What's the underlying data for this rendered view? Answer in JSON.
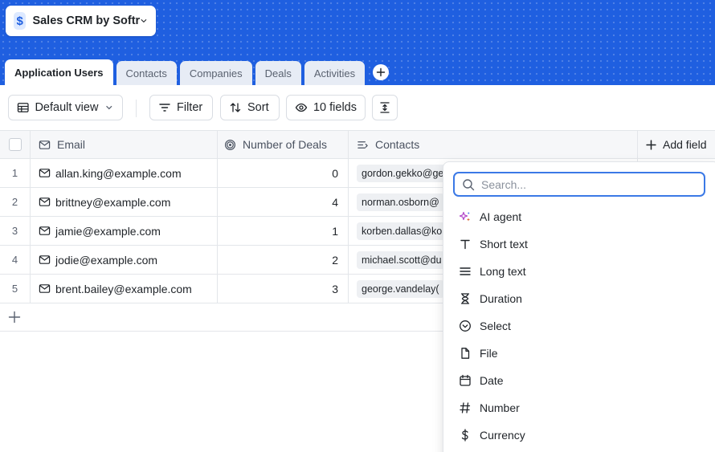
{
  "app": {
    "title": "Sales CRM by Softr",
    "logo_glyph": "$",
    "brand_color": "#1f5fe0"
  },
  "tabs": [
    {
      "label": "Application Users",
      "active": true
    },
    {
      "label": "Contacts",
      "active": false
    },
    {
      "label": "Companies",
      "active": false
    },
    {
      "label": "Deals",
      "active": false
    },
    {
      "label": "Activities",
      "active": false
    }
  ],
  "toolbar": {
    "view_label": "Default view",
    "filter_label": "Filter",
    "sort_label": "Sort",
    "fields_label": "10 fields"
  },
  "columns": {
    "email": "Email",
    "deals": "Number of Deals",
    "contacts": "Contacts",
    "add_field": "Add field"
  },
  "rows": [
    {
      "num": "1",
      "email": "allan.king@example.com",
      "deals": "0",
      "contact": "gordon.gekko@ge"
    },
    {
      "num": "2",
      "email": "brittney@example.com",
      "deals": "4",
      "contact": "norman.osborn@"
    },
    {
      "num": "3",
      "email": "jamie@example.com",
      "deals": "1",
      "contact": "korben.dallas@ko"
    },
    {
      "num": "4",
      "email": "jodie@example.com",
      "deals": "2",
      "contact": "michael.scott@du"
    },
    {
      "num": "5",
      "email": "brent.bailey@example.com",
      "deals": "3",
      "contact": "george.vandelay("
    }
  ],
  "field_menu": {
    "search_placeholder": "Search...",
    "items": [
      {
        "label": "AI agent",
        "icon": "sparkle-icon"
      },
      {
        "label": "Short text",
        "icon": "text-t-icon"
      },
      {
        "label": "Long text",
        "icon": "lines-icon"
      },
      {
        "label": "Duration",
        "icon": "hourglass-icon"
      },
      {
        "label": "Select",
        "icon": "chevron-circle-icon"
      },
      {
        "label": "File",
        "icon": "file-icon"
      },
      {
        "label": "Date",
        "icon": "calendar-icon"
      },
      {
        "label": "Number",
        "icon": "hash-icon"
      },
      {
        "label": "Currency",
        "icon": "dollar-icon"
      }
    ]
  }
}
